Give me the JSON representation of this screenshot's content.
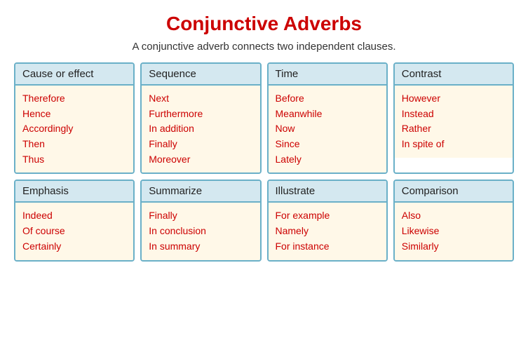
{
  "title": "Conjunctive Adverbs",
  "subtitle": "A conjunctive adverb connects two independent clauses.",
  "cards": [
    {
      "header": "Cause or effect",
      "items": [
        "Therefore",
        "Hence",
        "Accordingly",
        "Then",
        "Thus"
      ]
    },
    {
      "header": "Sequence",
      "items": [
        "Next",
        "Furthermore",
        "In addition",
        "Finally",
        "Moreover"
      ]
    },
    {
      "header": "Time",
      "items": [
        "Before",
        "Meanwhile",
        "Now",
        "Since",
        "Lately"
      ]
    },
    {
      "header": "Contrast",
      "items": [
        "However",
        "Instead",
        "Rather",
        "In spite of"
      ]
    },
    {
      "header": "Emphasis",
      "items": [
        "Indeed",
        "Of course",
        "Certainly"
      ]
    },
    {
      "header": "Summarize",
      "items": [
        "Finally",
        "In conclusion",
        "In summary"
      ]
    },
    {
      "header": "Illustrate",
      "items": [
        "For example",
        "Namely",
        "For instance"
      ]
    },
    {
      "header": "Comparison",
      "items": [
        "Also",
        "Likewise",
        "Similarly"
      ]
    }
  ]
}
